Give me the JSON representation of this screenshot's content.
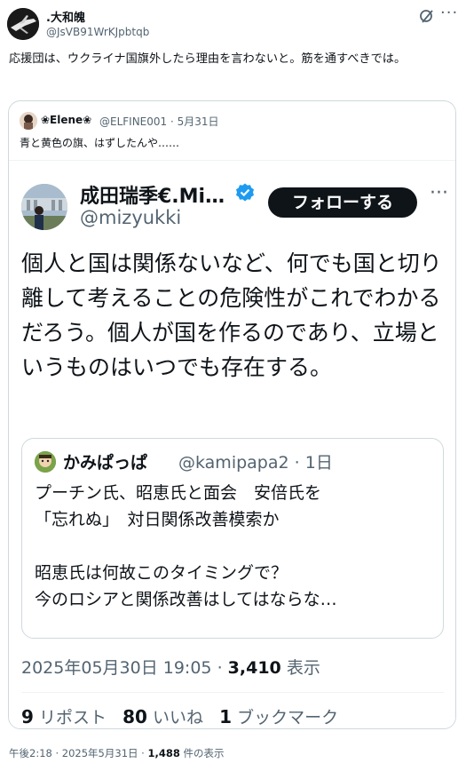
{
  "post": {
    "author_name": ".大和魄",
    "author_handle": "@JsVB91WrKJpbtqb",
    "text": "応援団は、ウクライナ国旗外したら理由を言わないと。筋を通すべきでは。",
    "more": "···"
  },
  "quote": {
    "author_name": "❀Elene❀",
    "author_handle": "@ELFINE001",
    "date": "5月31日",
    "text": "青と黄色の旗、はずしたんや……"
  },
  "embedded_tweet": {
    "author_name": "成田瑞季€.Mi…",
    "author_handle": "@mizyukki",
    "follow_label": "フォローする",
    "more": "···",
    "text": "個人と国は関係ないなど、何でも国と切り離して考えることの危険性がこれでわかるだろう。個人が国を作るのであり、立場というものはいつでも存在する。",
    "quoted": {
      "author_name": "かみぱっぱ",
      "author_handle": "@kamipapa2",
      "age": "1日",
      "line1": "プーチン氏、昭恵氏と面会　安倍氏を",
      "line2": "「忘れぬ」　対日関係改善模索か",
      "line3": "昭恵氏は何故このタイミングで？",
      "line4": "今のロシアと関係改善はしてはならな…"
    },
    "timestamp": "2025年05月30日 19:05",
    "views_count": "3,410",
    "views_label": "表示",
    "reposts_count": "9",
    "reposts_label": "リポスト",
    "likes_count": "80",
    "likes_label": "いいね",
    "bookmarks_count": "1",
    "bookmarks_label": "ブックマーク"
  },
  "footer": {
    "time": "午後2:18 · 2025年5月31日 · ",
    "views": "1,488",
    "views_label": " 件の表示"
  },
  "colors": {
    "text": "#0f1419",
    "muted": "#536471",
    "border": "#cfd9de",
    "verified": "#1d9bf0"
  }
}
